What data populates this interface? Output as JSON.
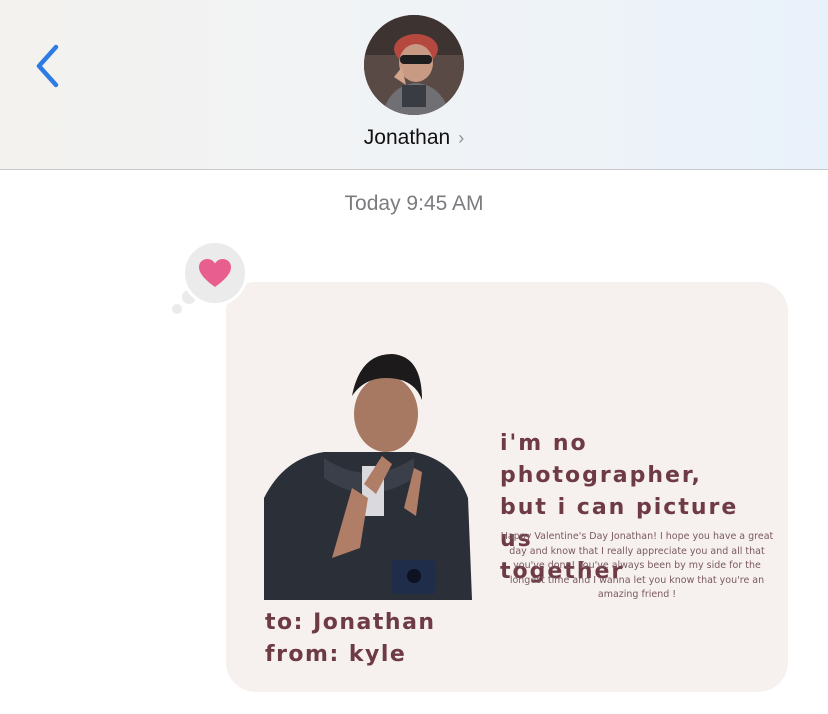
{
  "header": {
    "back_icon": "chevron-left-icon",
    "contact_name": "Jonathan",
    "contact_chevron": "›",
    "accent_color": "#2f7be5"
  },
  "conversation": {
    "timestamp": "Today 9:45 AM",
    "tapback": {
      "icon": "heart-icon",
      "color": "#e85f8f"
    },
    "message_card": {
      "headline_line1": "i'm no photographer,",
      "headline_line2": "but i can picture us",
      "headline_line3": "together",
      "body": "Happy Valentine's Day Jonathan! I hope you have a great day and know that I really appreciate you and all that you've done! You've always been by my side for the longest time and I wanna let you know that you're an amazing friend !",
      "to_line": "to: Jonathan",
      "from_line": "from: kyle"
    }
  }
}
